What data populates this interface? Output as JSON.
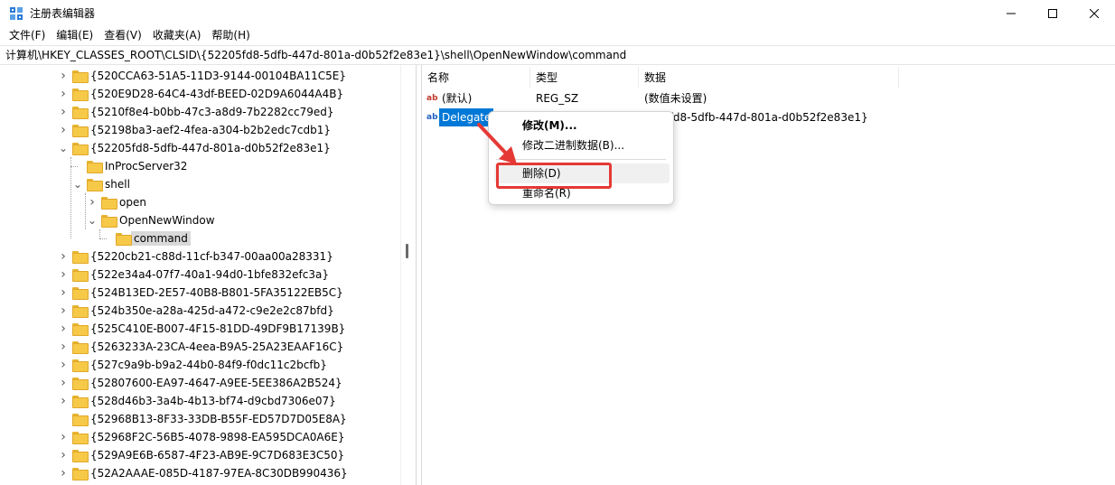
{
  "window": {
    "title": "注册表编辑器",
    "minimize": "—",
    "maximize": "☐",
    "close": "✕"
  },
  "menu": [
    "文件(F)",
    "编辑(E)",
    "查看(V)",
    "收藏夹(A)",
    "帮助(H)"
  ],
  "address": "计算机\\HKEY_CLASSES_ROOT\\CLSID\\{52205fd8-5dfb-447d-801a-d0b52f2e83e1}\\shell\\OpenNewWindow\\command",
  "tree": [
    {
      "label": "{520CCA63-51A5-11D3-9144-00104BA11C5E}",
      "level": 0,
      "chevron": "right"
    },
    {
      "label": "{520E9D28-64C4-43df-BEED-02D9A6044A4B}",
      "level": 0,
      "chevron": "right"
    },
    {
      "label": "{5210f8e4-b0bb-47c3-a8d9-7b2282cc79ed}",
      "level": 0,
      "chevron": "right"
    },
    {
      "label": "{52198ba3-aef2-4fea-a304-b2b2edc7cdb1}",
      "level": 0,
      "chevron": "right"
    },
    {
      "label": "{52205fd8-5dfb-447d-801a-d0b52f2e83e1}",
      "level": 0,
      "chevron": "down"
    },
    {
      "label": "InProcServer32",
      "level": 1,
      "chevron": "none"
    },
    {
      "label": "shell",
      "level": 1,
      "chevron": "down"
    },
    {
      "label": "open",
      "level": 2,
      "chevron": "right"
    },
    {
      "label": "OpenNewWindow",
      "level": 2,
      "chevron": "down"
    },
    {
      "label": "command",
      "level": 3,
      "chevron": "none",
      "selected": true
    },
    {
      "label": "{5220cb21-c88d-11cf-b347-00aa00a28331}",
      "level": 0,
      "chevron": "right"
    },
    {
      "label": "{522e34a4-07f7-40a1-94d0-1bfe832efc3a}",
      "level": 0,
      "chevron": "right"
    },
    {
      "label": "{524B13ED-2E57-40B8-B801-5FA35122EB5C}",
      "level": 0,
      "chevron": "right"
    },
    {
      "label": "{524b350e-a28a-425d-a472-c9e2e2c87bfd}",
      "level": 0,
      "chevron": "right"
    },
    {
      "label": "{525C410E-B007-4F15-81DD-49DF9B17139B}",
      "level": 0,
      "chevron": "right"
    },
    {
      "label": "{5263233A-23CA-4eea-B9A5-25A23EAAF16C}",
      "level": 0,
      "chevron": "right"
    },
    {
      "label": "{527c9a9b-b9a2-44b0-84f9-f0dc11c2bcfb}",
      "level": 0,
      "chevron": "right"
    },
    {
      "label": "{52807600-EA97-4647-A9EE-5EE386A2B524}",
      "level": 0,
      "chevron": "right"
    },
    {
      "label": "{528d46b3-3a4b-4b13-bf74-d9cbd7306e07}",
      "level": 0,
      "chevron": "right"
    },
    {
      "label": "{52968B13-8F33-33DB-B55F-ED57D7D05E8A}",
      "level": 0,
      "chevron": "none"
    },
    {
      "label": "{52968F2C-56B5-4078-9898-EA595DCA0A6E}",
      "level": 0,
      "chevron": "right"
    },
    {
      "label": "{529A9E6B-6587-4F23-AB9E-9C7D683E3C50}",
      "level": 0,
      "chevron": "right"
    },
    {
      "label": "{52A2AAAE-085D-4187-97EA-8C30DB990436}",
      "level": 0,
      "chevron": "right"
    }
  ],
  "columns": [
    "名称",
    "类型",
    "数据"
  ],
  "values": [
    {
      "name": "(默认)",
      "type": "REG_SZ",
      "data": "(数值未设置)",
      "icon": "ab",
      "selected": false
    },
    {
      "name": "Delegate",
      "type": "",
      "data": "5fd8-5dfb-447d-801a-d0b52f2e83e1}",
      "icon": "ab",
      "selected": true
    }
  ],
  "context_menu": {
    "items": [
      {
        "label": "修改(M)...",
        "bold": true
      },
      {
        "label": "修改二进制数据(B)...",
        "bold": false
      },
      {
        "label": "删除(D)",
        "bold": false,
        "hover": true
      },
      {
        "label": "重命名(R)",
        "bold": false
      }
    ]
  },
  "colors": {
    "selection": "#0078d7",
    "annotation": "#e53935",
    "folder": "#f7c948"
  }
}
